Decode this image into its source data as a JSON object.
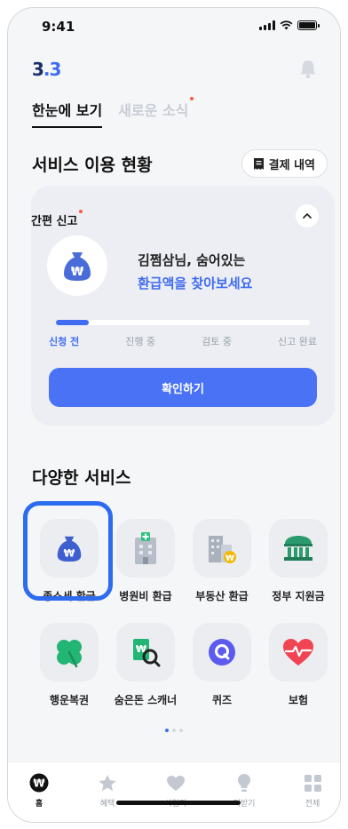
{
  "status": {
    "time": "9:41"
  },
  "logo": {
    "main": "3",
    "accent": ".3",
    "tail": ""
  },
  "tabs": [
    {
      "label": "한눈에 보기"
    },
    {
      "label": "새로운 소식"
    }
  ],
  "usage": {
    "title": "서비스 이용 현황",
    "receipt_label": "결제 내역",
    "card": {
      "label": "간편 신고",
      "message_line1": "김쩜삼님, 숨어있는",
      "message_line2": "환급액을 찾아보세요",
      "progress": 0.13,
      "steps": [
        "신청 전",
        "진행 중",
        "검토 중",
        "신고 완료"
      ],
      "confirm_label": "확인하기"
    }
  },
  "services": {
    "title": "다양한 서비스",
    "items": [
      {
        "label": "종소세 환급",
        "icon": "money-bag-icon"
      },
      {
        "label": "병원비 환급",
        "icon": "hospital-icon"
      },
      {
        "label": "부동산 환급",
        "icon": "building-icon"
      },
      {
        "label": "정부 지원금",
        "icon": "government-icon"
      },
      {
        "label": "행운복권",
        "icon": "clover-icon"
      },
      {
        "label": "숨은돈 스캐너",
        "icon": "scanner-icon"
      },
      {
        "label": "퀴즈",
        "icon": "quiz-icon"
      },
      {
        "label": "보험",
        "icon": "heart-pulse-icon"
      }
    ]
  },
  "nav": [
    {
      "label": "홈"
    },
    {
      "label": "혜택"
    },
    {
      "label": "사업자"
    },
    {
      "label": "더받기"
    },
    {
      "label": "전체"
    }
  ],
  "colors": {
    "accent": "#3f6cf0",
    "button": "#4a72f5",
    "highlight": "#2d6cf0",
    "notify": "#ff5a3a"
  }
}
